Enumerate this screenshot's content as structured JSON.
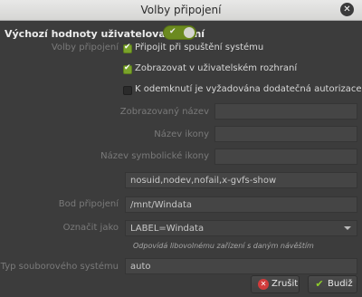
{
  "window": {
    "title": "Volby připojení",
    "close_icon": "close-icon"
  },
  "session": {
    "heading": "Výchozí hodnoty uživatelova sezení",
    "toggle_on": true
  },
  "mount_options": {
    "label": "Volby připojení",
    "checkboxes": [
      {
        "label": "Připojit při spuštění systému",
        "checked": true
      },
      {
        "label": "Zobrazovat v uživatelském rozhraní",
        "checked": true
      },
      {
        "label": "K odemknutí je vyžadována dodatečná autorizace",
        "checked": false
      }
    ]
  },
  "fields": {
    "display_name_label": "Zobrazovaný název",
    "display_name_value": "",
    "icon_name_label": "Název ikony",
    "icon_name_value": "",
    "symbolic_icon_label": "Název symbolické ikony",
    "symbolic_icon_value": "",
    "options_value": "nosuid,nodev,nofail,x-gvfs-show",
    "mount_point_label": "Bod připojení",
    "mount_point_value": "/mnt/Windata",
    "identify_as_label": "Označit jako",
    "identify_as_value": "LABEL=Windata",
    "identify_as_hint": "Odpovídá libovolnému zařízení s daným návěštím",
    "fs_type_label": "Typ souborového systému",
    "fs_type_value": "auto"
  },
  "buttons": {
    "cancel_label": "Zrušit",
    "ok_label": "Budiž"
  },
  "colors": {
    "accent": "#7aa32a",
    "toggle_on": "#6b8a1f",
    "cancel_icon": "#d23b3b",
    "ok_icon": "#7aa32a"
  }
}
